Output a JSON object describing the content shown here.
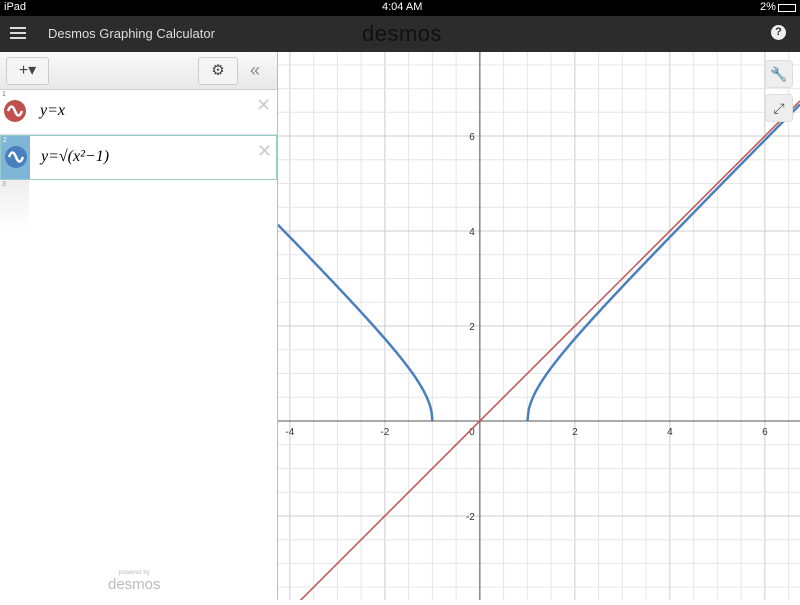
{
  "status": {
    "device": "iPad",
    "time": "4:04 AM",
    "battery": "2%"
  },
  "header": {
    "title": "Desmos Graphing Calculator",
    "logo": "desmos",
    "help": "?"
  },
  "toolbar": {
    "add": "+▾",
    "settings": "⚙",
    "collapse": "«"
  },
  "expressions": [
    {
      "index": "1",
      "latex_text": "y=x",
      "color": "#c0504d"
    },
    {
      "index": "2",
      "latex_text": "y=√(x²−1)",
      "color": "#4a7fbf"
    },
    {
      "index": "3",
      "latex_text": ""
    }
  ],
  "powered_by": {
    "small": "powered by",
    "logo": "desmos"
  },
  "graph_tools": {
    "wrench": "🔧",
    "zoom": "⤢"
  },
  "chart_data": {
    "type": "line",
    "xlim": [
      -4.25,
      6.74
    ],
    "ylim": [
      -3.77,
      7.77
    ],
    "grid": true,
    "x_ticks": [
      "-4",
      "-2",
      "0",
      "2",
      "4",
      "6"
    ],
    "y_ticks": [
      "-2",
      "2",
      "4",
      "6"
    ],
    "series": [
      {
        "name": "y=x",
        "color": "#c0504d"
      },
      {
        "name": "y=sqrt(x^2-1)",
        "color": "#4a7fbf"
      }
    ]
  }
}
